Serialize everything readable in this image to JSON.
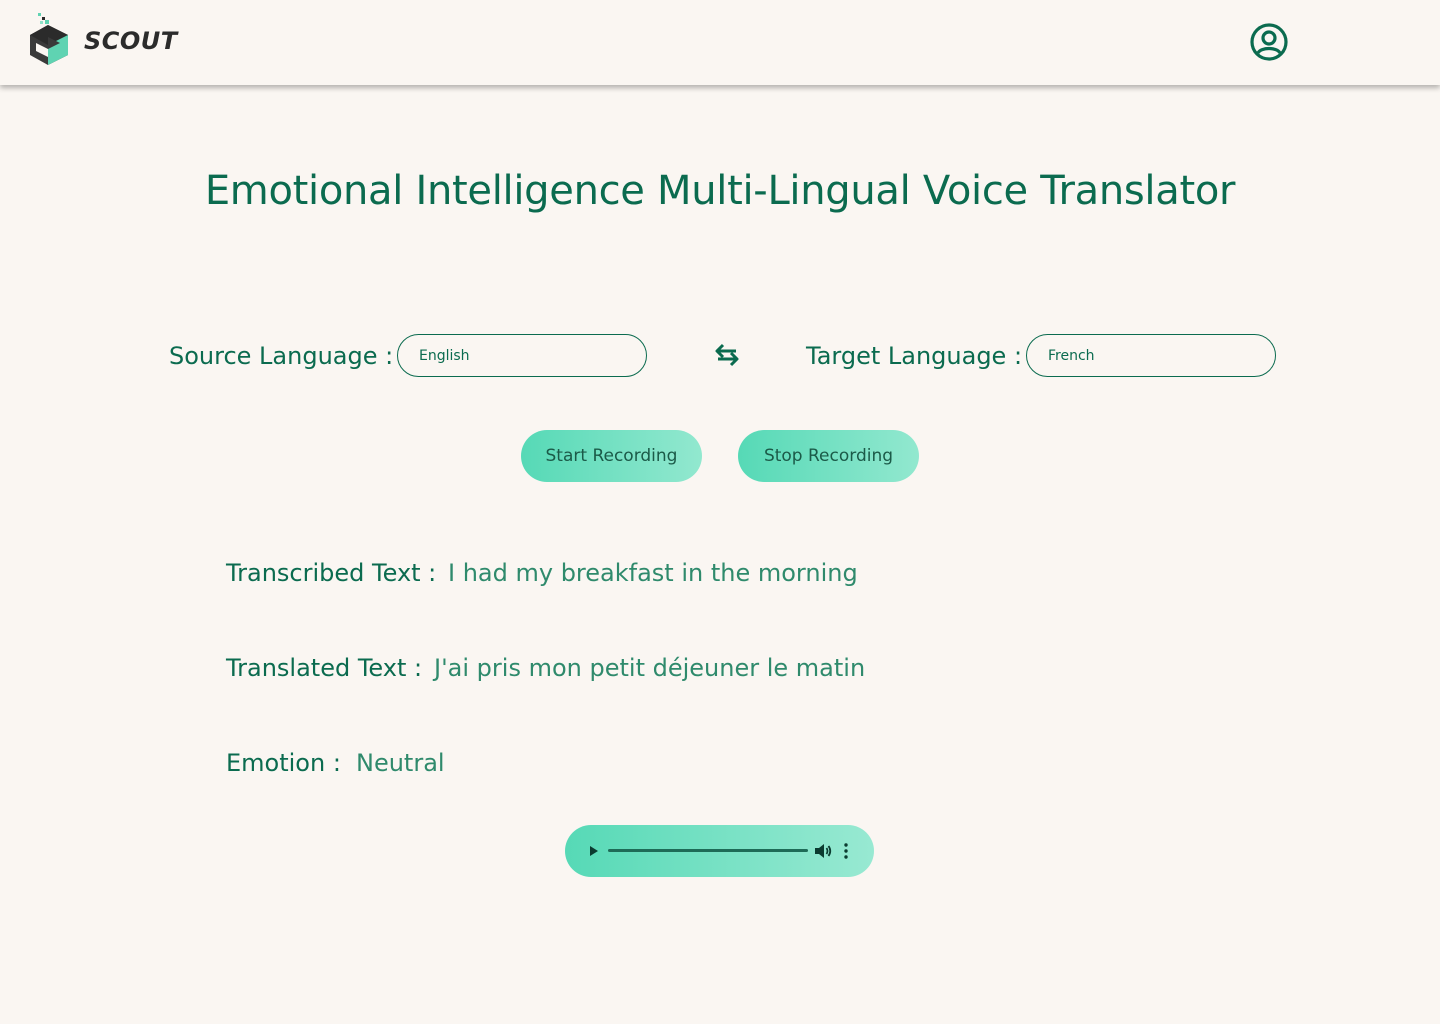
{
  "header": {
    "brand": "SCOUT",
    "logo_icon": "scout-cube-logo",
    "profile_icon": "user-circle-icon"
  },
  "main": {
    "title": "Emotional Intelligence Multi-Lingual Voice Translator",
    "source": {
      "label": "Source Language :",
      "value": "English"
    },
    "swap_icon": "swap-arrows-icon",
    "target": {
      "label": "Target Language :",
      "value": "French"
    },
    "buttons": {
      "start": "Start Recording",
      "stop": "Stop Recording"
    },
    "transcribed": {
      "label": "Transcribed Text :",
      "value": "I had my breakfast in the morning"
    },
    "translated": {
      "label": "Translated Text :",
      "value": "J'ai pris mon petit déjeuner le matin"
    },
    "emotion": {
      "label": "Emotion :",
      "value": "Neutral"
    },
    "audio": {
      "progress": 0,
      "icons": [
        "play-icon",
        "volume-icon",
        "more-options-icon"
      ]
    }
  },
  "colors": {
    "background": "#faf6f2",
    "primary": "#0b6b4f",
    "value_text": "#2f8a6c",
    "button_gradient_start": "#56d9b6",
    "button_gradient_end": "#92e8cf",
    "brand_text": "#2b2b2b"
  }
}
